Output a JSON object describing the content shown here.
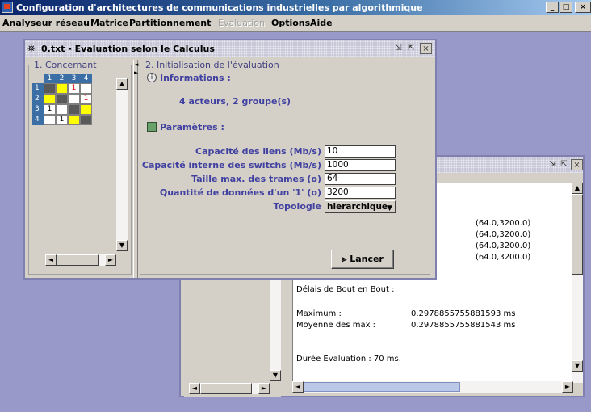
{
  "window": {
    "title": "Configuration d'architectures de communications industrielles par algorithmique",
    "controls": [
      "_",
      "□",
      "×"
    ]
  },
  "menu": [
    {
      "label": "Analyseur réseau",
      "enabled": true
    },
    {
      "label": "Matrice",
      "enabled": true
    },
    {
      "label": "Partitionnement",
      "enabled": true
    },
    {
      "label": "Evaluation",
      "enabled": false
    },
    {
      "label": "Options",
      "enabled": true
    },
    {
      "label": "Aide",
      "enabled": true
    }
  ],
  "eval_frame": {
    "title": "0.txt - Evaluation selon le Calculus",
    "concernant": {
      "label": "1. Concernant",
      "col_headers": [
        "1",
        "2",
        "3",
        "4"
      ],
      "row_headers": [
        "1",
        "2",
        "3",
        "4"
      ],
      "cells": [
        [
          "gray",
          "yellow",
          "1",
          "white"
        ],
        [
          "yellow",
          "gray",
          "white",
          "1"
        ],
        [
          "1",
          "white",
          "gray",
          "yellow"
        ],
        [
          "white",
          "1",
          "yellow",
          "gray"
        ]
      ]
    },
    "init": {
      "label": "2. Initialisation de l'évaluation",
      "informations_label": "Informations :",
      "info_text": "4 acteurs, 2 groupe(s)",
      "parametres_label": "Paramètres :",
      "fields": [
        {
          "label": "Capacité des liens (Mb/s)",
          "value": "10"
        },
        {
          "label": "Capacité interne des switchs (Mb/s)",
          "value": "1000"
        },
        {
          "label": "Taille max. des trames (o)",
          "value": "64"
        },
        {
          "label": "Quantité de données d'un '1' (o)",
          "value": "3200"
        }
      ],
      "topologie_label": "Topologie",
      "topologie_value": "hierarchique",
      "lancer_label": "Lancer"
    }
  },
  "result_frame": {
    "pairs": [
      "(64.0,3200.0)",
      "(64.0,3200.0)",
      "(64.0,3200.0)",
      "(64.0,3200.0)"
    ],
    "delais_label": "Délais de Bout en Bout :",
    "maximum_label": "Maximum :",
    "maximum_value": "0.2978855755881593 ms",
    "moyenne_label": "Moyenne des max :",
    "moyenne_value": "0.2978855755881543 ms",
    "duree_label": "Durée Evaluation : 70 ms."
  },
  "colors": {
    "title_blue": "#0a246a",
    "desktop": "#9999c9",
    "label_blue": "#4040a0",
    "matrix_yellow": "#ffff00",
    "matrix_gray": "#5a5a5a",
    "matrix_red_text": "#e00000"
  },
  "icons": {
    "binoculars": "binoculars-icon",
    "info": "info-icon",
    "params": "params-icon",
    "lancer": "double-chevron-icon"
  }
}
